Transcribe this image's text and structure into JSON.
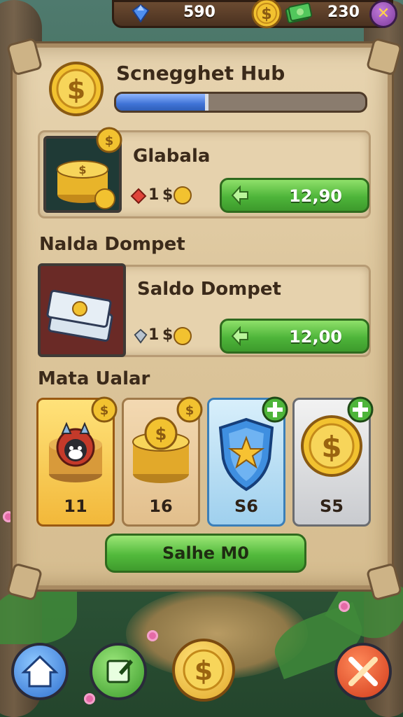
{
  "top_bar": {
    "gems": "590",
    "cash": "230"
  },
  "hub": {
    "title": "Scnegghet Hub",
    "progress": 0.37
  },
  "offer_1": {
    "title": "Glabala",
    "cost_amount": "1",
    "cost_symbol": "$",
    "price": "12,90"
  },
  "section_1": {
    "title": "Nalda Dompet"
  },
  "offer_2": {
    "title": "Saldo Dompet",
    "cost_amount": "1",
    "cost_symbol": "$",
    "price": "12,00"
  },
  "section_2": {
    "title": "Mata Ualar"
  },
  "tiles": [
    {
      "label": "11",
      "icon": "cat-coin-icon",
      "badge": "coin-badge-icon"
    },
    {
      "label": "16",
      "icon": "coin-stack-icon",
      "badge": "coin-badge-icon"
    },
    {
      "label": "S6",
      "icon": "shield-star-icon",
      "badge": "plus-badge-icon"
    },
    {
      "label": "S5",
      "icon": "gold-coin-icon",
      "badge": "plus-badge-icon"
    }
  ],
  "collect_button": {
    "label": "Salhe M0"
  },
  "colors": {
    "accent_green": "#4eb53a",
    "progress_blue": "#3f73d6",
    "parchment": "#dcc59b",
    "coin_gold": "#f2c230"
  }
}
